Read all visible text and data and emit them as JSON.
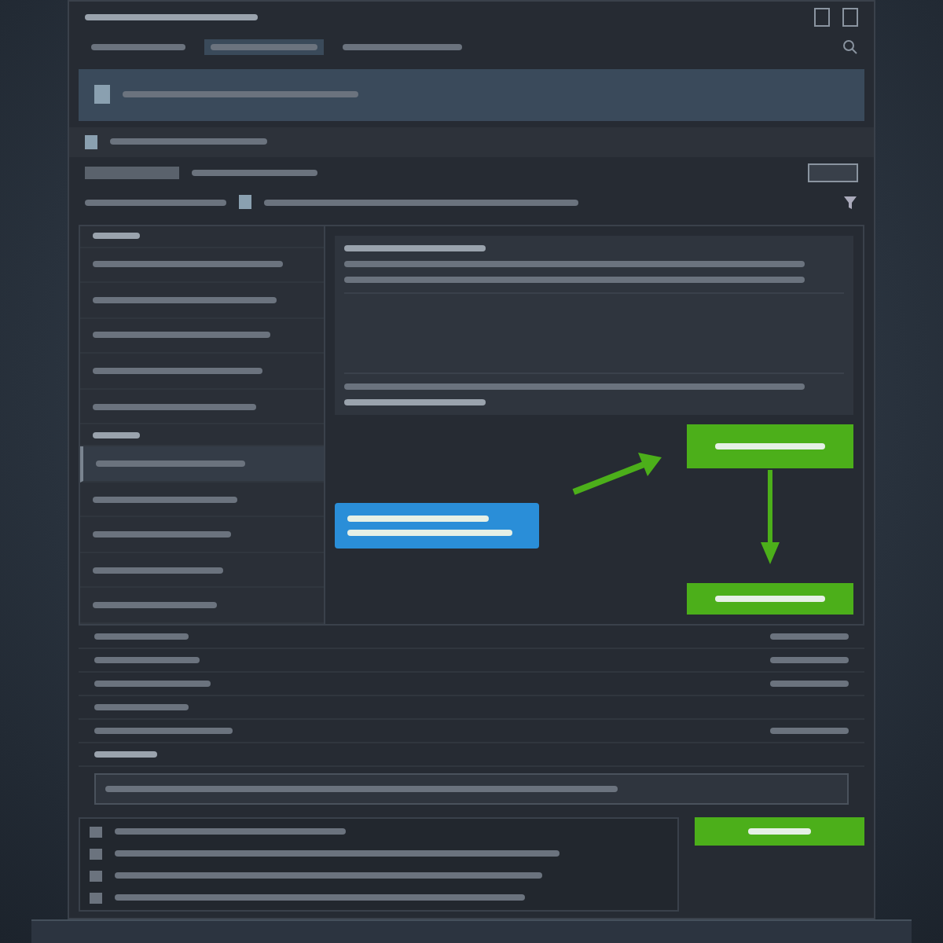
{
  "header": {
    "tabs": [
      {
        "selected": false
      },
      {
        "selected": true
      },
      {
        "selected": false
      }
    ]
  },
  "sidebar": {
    "items": [
      {
        "kind": "heading",
        "selected": false
      },
      {
        "kind": "item",
        "selected": false
      },
      {
        "kind": "item",
        "selected": false
      },
      {
        "kind": "item",
        "selected": false
      },
      {
        "kind": "item",
        "selected": false
      },
      {
        "kind": "item",
        "selected": false
      },
      {
        "kind": "heading",
        "selected": false
      },
      {
        "kind": "item",
        "selected": true
      },
      {
        "kind": "item",
        "selected": false
      },
      {
        "kind": "item",
        "selected": false
      },
      {
        "kind": "item",
        "selected": false
      },
      {
        "kind": "item",
        "selected": false
      }
    ]
  },
  "detail": {
    "lines": [
      {
        "kind": "heading"
      },
      {
        "kind": "body"
      },
      {
        "kind": "body"
      },
      {
        "kind": "spacer"
      },
      {
        "kind": "body"
      },
      {
        "kind": "heading"
      }
    ]
  },
  "callouts": [
    {
      "kind": "tooltip"
    },
    {
      "kind": "button"
    },
    {
      "kind": "button"
    }
  ],
  "settings": {
    "rows": [
      {
        "kind": "value"
      },
      {
        "kind": "value"
      },
      {
        "kind": "value"
      },
      {
        "kind": "label"
      },
      {
        "kind": "value"
      },
      {
        "kind": "heading"
      },
      {
        "kind": "field"
      }
    ]
  },
  "footer": {
    "rows": [
      {
        "kind": "item"
      },
      {
        "kind": "item"
      },
      {
        "kind": "item"
      },
      {
        "kind": "item"
      }
    ],
    "primary": {
      "kind": "primary"
    }
  }
}
